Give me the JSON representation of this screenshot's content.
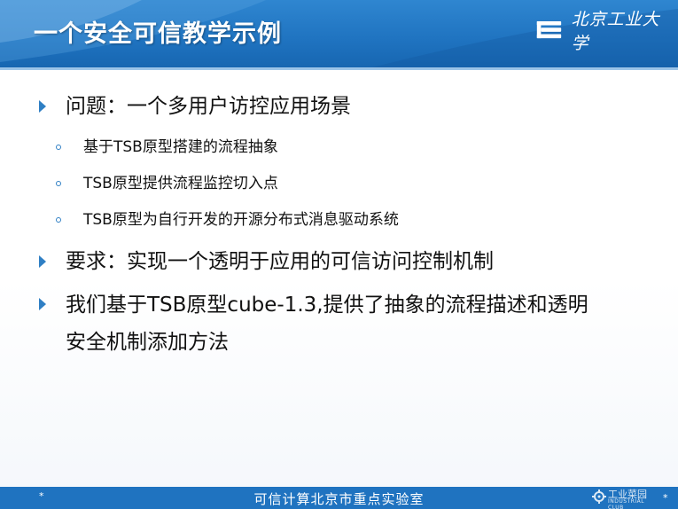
{
  "header": {
    "title": "一个安全可信教学示例",
    "logo_text": "北京工业大学"
  },
  "bullets": [
    {
      "text": "问题：一个多用户访控应用场景",
      "sub": [
        "基于TSB原型搭建的流程抽象",
        "TSB原型提供流程监控切入点",
        "TSB原型为自行开发的开源分布式消息驱动系统"
      ]
    },
    {
      "text": "要求：实现一个透明于应用的可信访问控制机制"
    },
    {
      "text_line1": "我们基于TSB原型cube-1.3,提供了抽象的流程描述和透明",
      "text_line2": "安全机制添加方法"
    }
  ],
  "footer": {
    "text": "可信计算北京市重点实验室",
    "mark_left": "*",
    "mark_right": "*"
  },
  "watermark": {
    "text": "工业菜园",
    "sub": "INDUSTRIAL CLUB"
  },
  "colors": {
    "header_blue": "#1f73c0",
    "bullet_blue": "#2f7fc4",
    "text": "#111111"
  }
}
